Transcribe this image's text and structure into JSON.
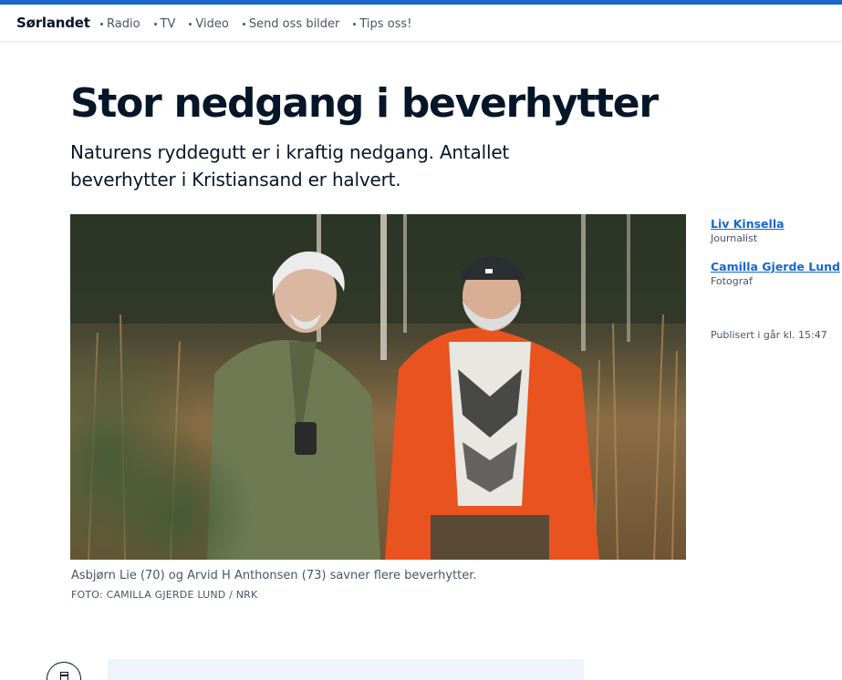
{
  "nav": {
    "brand": "Sørlandet",
    "links": [
      "Radio",
      "TV",
      "Video",
      "Send oss bilder",
      "Tips oss!"
    ]
  },
  "article": {
    "headline": "Stor nedgang i beverhytter",
    "lead": "Naturens ryddegutt er i kraftig nedgang. Antallet beverhytter i Kristiansand er halvert.",
    "caption": "Asbjørn Lie (70) og Arvid H Anthonsen (73) savner flere beverhytter.",
    "credit": "FOTO: CAMILLA GJERDE LUND / NRK"
  },
  "bylines": [
    {
      "name": "Liv Kinsella",
      "role": "Journalist"
    },
    {
      "name": "Camilla Gjerde Lund",
      "role": "Fotograf"
    }
  ],
  "published": "Publisert i går kl. 15:47",
  "colors": {
    "accent": "#1767ce",
    "text": "#061629",
    "muted": "#4b5563",
    "jacket_orange": "#e8531f",
    "jacket_green": "#6f7a52"
  }
}
